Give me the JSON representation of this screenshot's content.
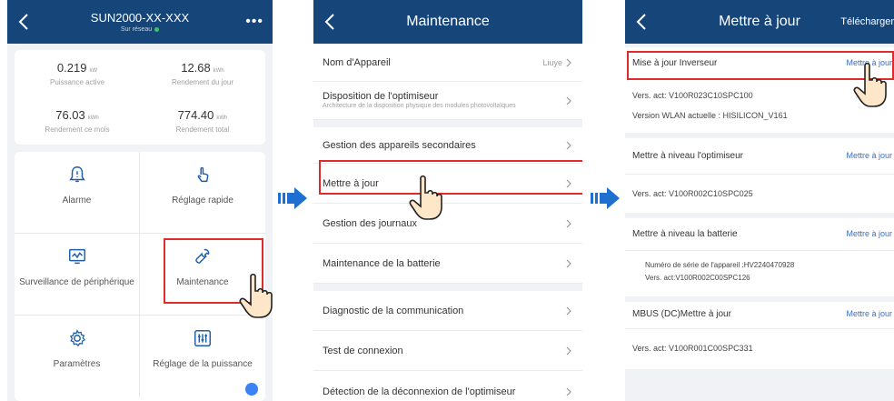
{
  "screen1": {
    "device_name": "SUN2000-XX-XXX",
    "status": "Sur réseau",
    "kpis": [
      {
        "value": "0.219",
        "unit": "kW",
        "label": "Puissance active"
      },
      {
        "value": "12.68",
        "unit": "kWh",
        "label": "Rendement du jour"
      },
      {
        "value": "76.03",
        "unit": "kWh",
        "label": "Rendement ce mois"
      },
      {
        "value": "774.40",
        "unit": "kWh",
        "label": "Rendement total"
      }
    ],
    "tiles": [
      {
        "label": "Alarme"
      },
      {
        "label": "Réglage rapide"
      },
      {
        "label": "Surveillance de périphérique"
      },
      {
        "label": "Maintenance"
      },
      {
        "label": "Paramètres"
      },
      {
        "label": "Réglage de la puissance"
      }
    ]
  },
  "screen2": {
    "title": "Maintenance",
    "rows": [
      {
        "label": "Nom d'Appareil",
        "value": "Liuye",
        "sub": ""
      },
      {
        "label": "Disposition de l'optimiseur",
        "value": "",
        "sub": "Architecture de la disposition physique des modules photovoltaïques"
      },
      {
        "label": "Gestion des appareils secondaires",
        "value": "",
        "sub": ""
      },
      {
        "label": "Mettre à jour",
        "value": "",
        "sub": ""
      },
      {
        "label": "Gestion des journaux",
        "value": "",
        "sub": ""
      },
      {
        "label": "Maintenance de la batterie",
        "value": "",
        "sub": ""
      },
      {
        "label": "Diagnostic de la communication",
        "value": "",
        "sub": ""
      },
      {
        "label": "Test de connexion",
        "value": "",
        "sub": ""
      },
      {
        "label": "Détection de la déconnexion de l'optimiseur",
        "value": "",
        "sub": ""
      }
    ]
  },
  "screen3": {
    "title": "Mettre à jour",
    "download": "Télécharger",
    "inverter": {
      "title": "Mise à jour Inverseur",
      "action": "Mettre à jour",
      "version": "Vers. act: V100R023C10SPC100",
      "wlan": "Version WLAN actuelle : HISILICON_V161"
    },
    "optimizer": {
      "title": "Mettre à niveau l'optimiseur",
      "action": "Mettre à jour",
      "version": "Vers. act: V100R002C10SPC025"
    },
    "battery": {
      "title": "Mettre à niveau la batterie",
      "action": "Mettre à jour",
      "serial": "Numéro de série de l'appareil :HV2240470928",
      "version": "Vers. act:V100R002C00SPC126"
    },
    "mbus": {
      "title": "MBUS (DC)Mettre à jour",
      "action": "Mettre à jour",
      "version": "Vers. act: V100R001C00SPC331"
    }
  },
  "colors": {
    "header": "#16457a",
    "highlight": "#e02b2b",
    "link": "#2f6fd6",
    "arrow": "#1e6fd0"
  }
}
